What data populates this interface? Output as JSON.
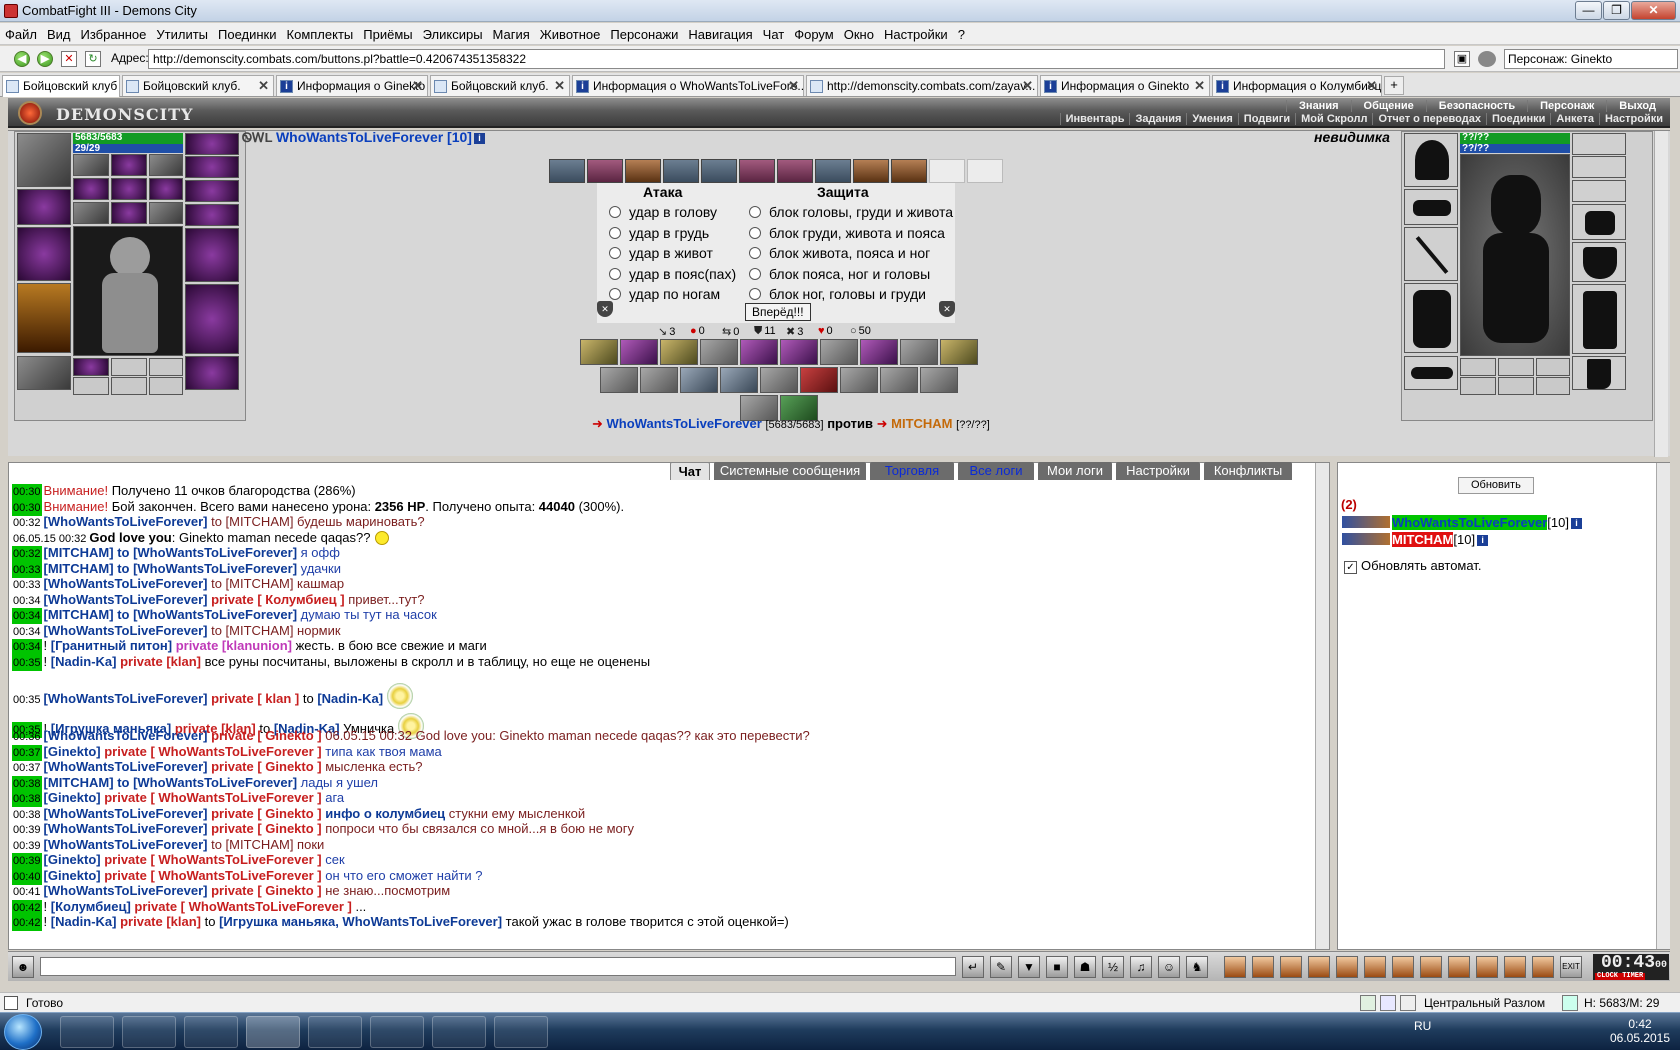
{
  "window": {
    "title": "CombatFight III - Demons City",
    "min": "0",
    "max": "1",
    "close": "r"
  },
  "menu": [
    "Файл",
    "Вид",
    "Избранное",
    "Утилиты",
    "Поединки",
    "Комплекты",
    "Приёмы",
    "Эликсиры",
    "Магия",
    "Животное",
    "Персонажи",
    "Навигация",
    "Чат",
    "Форум",
    "Окно",
    "Настройки",
    "?"
  ],
  "address": {
    "label": "Адрес:",
    "url": "http://demonscity.combats.com/buttons.pl?battle=0.420674351358322",
    "character_label": "Персонаж:",
    "character": "Ginekto"
  },
  "tabs": [
    "Бойцовский клуб",
    "Бойцовский клуб.",
    "Информация о Ginekto",
    "Бойцовский клуб.",
    "Информация о WhoWantsToLiveFore...",
    "http://demonscity.combats.com/zayav...",
    "Информация о Ginekto",
    "Информация о Колумбиец"
  ],
  "game": {
    "logo": "DEMONSCITY",
    "nav_top": [
      "Знания",
      "Общение",
      "Безопасность",
      "Персонаж",
      "Выход"
    ],
    "nav_bottom": [
      "Инвентарь",
      "Задания",
      "Умения",
      "Подвиги",
      "Мой Скролл",
      "Отчет о переводах",
      "Поединки",
      "Анкета",
      "Настройки"
    ],
    "player": {
      "name": "WhoWantsToLiveForever [10]",
      "hp": "5683/5683",
      "mp": "29/29",
      "clan_tag": "ᏫᎳL"
    },
    "enemy": {
      "hp": "??/??",
      "mp": "??/??",
      "label": "невидимка"
    },
    "attack_header": "Атака",
    "defense_header": "Защита",
    "attacks": [
      "удар в голову",
      "удар в грудь",
      "удар в живот",
      "удар в пояс(пах)",
      "удар по ногам"
    ],
    "defenses": [
      "блок головы, груди и живота",
      "блок груди, живота и пояса",
      "блок живота, пояса и ног",
      "блок пояса, ног и головы",
      "блок ног, головы и груди"
    ],
    "forward_button": "Вперёд!!!",
    "stats": [
      {
        "icon": "sword-icon",
        "value": "3"
      },
      {
        "icon": "blood-icon",
        "value": "0"
      },
      {
        "icon": "arrows-icon",
        "value": "0"
      },
      {
        "icon": "shield-icon",
        "value": "11"
      },
      {
        "icon": "cross-icon",
        "value": "3"
      },
      {
        "icon": "heart-icon",
        "value": "0"
      },
      {
        "icon": "drop-icon",
        "value": "50"
      }
    ],
    "versus": {
      "left_name": "WhoWantsToLiveForever",
      "left_hp": "[5683/5683]",
      "word": "против",
      "right_name": "MITCHAM",
      "right_hp": "[??/??]"
    },
    "colors": {
      "player": "#0a3fbd",
      "enemy": "#c46a0a",
      "hp": "#129b25",
      "mp": "#1f4fa8"
    }
  },
  "chat": {
    "tabs": [
      "Чат",
      "Системные сообщения",
      "Торговля",
      "Все логи",
      "Мои логи",
      "Настройки",
      "Конфликты"
    ],
    "lines": [
      {
        "t": "00:30",
        "g": true,
        "parts": [
          {
            "c": "rdn",
            "x": "Внимание!"
          },
          {
            "c": "bk",
            "x": " Получено 11 очков благородства (286%)"
          }
        ]
      },
      {
        "t": "00:30",
        "g": true,
        "parts": [
          {
            "c": "rdn",
            "x": "Внимание!"
          },
          {
            "c": "bk",
            "x": " Бой закончен. Всего вами нанесено урона: "
          },
          {
            "c": "bk bold",
            "x": "2356 HP"
          },
          {
            "c": "bk",
            "x": ". Получено опыта: "
          },
          {
            "c": "bk bold",
            "x": "44040"
          },
          {
            "c": "bk",
            "x": " (300%)."
          }
        ]
      },
      {
        "t": "00:32",
        "g": false,
        "parts": [
          {
            "c": "nm",
            "x": "[WhoWantsToLiveForever]"
          },
          {
            "c": "br",
            "x": " to [MITCHAM] будешь мариновать?"
          }
        ]
      },
      {
        "t": "06.05.15 00:32",
        "g": false,
        "parts": [
          {
            "c": "bk bold",
            "x": "God love you"
          },
          {
            "c": "bk",
            "x": ": Ginekto maman necede qaqas??"
          }
        ],
        "smile": true
      },
      {
        "t": "00:32",
        "g": true,
        "parts": [
          {
            "c": "nm",
            "x": "[MITCHAM]"
          },
          {
            "c": "nm",
            "x": " to [WhoWantsToLiveForever]"
          },
          {
            "c": "bl",
            "x": " я офф"
          }
        ]
      },
      {
        "t": "00:33",
        "g": true,
        "parts": [
          {
            "c": "nm",
            "x": "[MITCHAM]"
          },
          {
            "c": "nm",
            "x": " to [WhoWantsToLiveForever]"
          },
          {
            "c": "bl",
            "x": " удачки"
          }
        ]
      },
      {
        "t": "00:33",
        "g": false,
        "parts": [
          {
            "c": "nm",
            "x": "[WhoWantsToLiveForever]"
          },
          {
            "c": "br",
            "x": " to [MITCHAM] кашмар"
          }
        ]
      },
      {
        "t": "00:34",
        "g": false,
        "parts": [
          {
            "c": "nm",
            "x": "[WhoWantsToLiveForever]"
          },
          {
            "c": "pr",
            "x": " private [ Колумбиец ]"
          },
          {
            "c": "br",
            "x": " привет...тут?"
          }
        ]
      },
      {
        "t": "00:34",
        "g": true,
        "parts": [
          {
            "c": "nm",
            "x": "[MITCHAM]"
          },
          {
            "c": "nm",
            "x": " to [WhoWantsToLiveForever]"
          },
          {
            "c": "bl",
            "x": " думаю ты тут на часок"
          }
        ]
      },
      {
        "t": "00:34",
        "g": false,
        "parts": [
          {
            "c": "nm",
            "x": "[WhoWantsToLiveForever]"
          },
          {
            "c": "br",
            "x": " to [MITCHAM] нормик"
          }
        ]
      },
      {
        "t": "00:34",
        "g": true,
        "parts": [
          {
            "c": "bk",
            "x": "! "
          },
          {
            "c": "nm",
            "x": "[Гранитный питон]"
          },
          {
            "c": "mg",
            "x": " private [klanunion]"
          },
          {
            "c": "bk",
            "x": " жесть. в бою все свежие и маги"
          }
        ]
      },
      {
        "t": "00:35",
        "g": true,
        "parts": [
          {
            "c": "bk",
            "x": "! "
          },
          {
            "c": "nm",
            "x": "[Nadin-Ka]"
          },
          {
            "c": "pr",
            "x": " private [klan]"
          },
          {
            "c": "bk",
            "x": " все руны посчитаны, выложены в скролл и в таблицу, но еще не оценены"
          }
        ]
      },
      {
        "t": "00:35",
        "g": false,
        "parts": [
          {
            "c": "nm",
            "x": "[WhoWantsToLiveForever]"
          },
          {
            "c": "pr",
            "x": " private [ klan ]"
          },
          {
            "c": "bk",
            "x": " to "
          },
          {
            "c": "nm",
            "x": "[Nadin-Ka]"
          }
        ],
        "flower": true
      },
      {
        "t": "00:35",
        "g": true,
        "parts": [
          {
            "c": "bk",
            "x": "! "
          },
          {
            "c": "nm",
            "x": "[Игрушка маньяка]"
          },
          {
            "c": "pr",
            "x": " private [klan]"
          },
          {
            "c": "bk",
            "x": " to "
          },
          {
            "c": "nm",
            "x": "[Nadin-Ka]"
          },
          {
            "c": "bk",
            "x": " Умничка"
          }
        ],
        "flower": true
      },
      {
        "t": "00:36",
        "g": false,
        "parts": [
          {
            "c": "nm",
            "x": "[WhoWantsToLiveForever]"
          },
          {
            "c": "pr",
            "x": " private [ Ginekto ]"
          },
          {
            "c": "br",
            "x": " 06.05.15 00:32 God love you: Ginekto maman necede qaqas?? как это перевести?"
          }
        ]
      },
      {
        "t": "00:37",
        "g": true,
        "parts": [
          {
            "c": "nm",
            "x": "[Ginekto]"
          },
          {
            "c": "pr",
            "x": " private [ WhoWantsToLiveForever ]"
          },
          {
            "c": "bl",
            "x": " типа как твоя мама"
          }
        ]
      },
      {
        "t": "00:37",
        "g": false,
        "parts": [
          {
            "c": "nm",
            "x": "[WhoWantsToLiveForever]"
          },
          {
            "c": "pr",
            "x": " private [ Ginekto ]"
          },
          {
            "c": "br",
            "x": " мысленка есть?"
          }
        ]
      },
      {
        "t": "00:38",
        "g": true,
        "parts": [
          {
            "c": "nm",
            "x": "[MITCHAM]"
          },
          {
            "c": "nm",
            "x": " to [WhoWantsToLiveForever]"
          },
          {
            "c": "bl",
            "x": " лады я ушел"
          }
        ]
      },
      {
        "t": "00:38",
        "g": true,
        "parts": [
          {
            "c": "nm",
            "x": "[Ginekto]"
          },
          {
            "c": "pr",
            "x": " private [ WhoWantsToLiveForever ]"
          },
          {
            "c": "bl",
            "x": " ага"
          }
        ]
      },
      {
        "t": "00:38",
        "g": false,
        "parts": [
          {
            "c": "nm",
            "x": "[WhoWantsToLiveForever]"
          },
          {
            "c": "pr",
            "x": " private [ Ginekto ]"
          },
          {
            "c": "nm",
            "x": " инфо о колумбиец"
          },
          {
            "c": "br",
            "x": " стукни ему мысленкой"
          }
        ]
      },
      {
        "t": "00:39",
        "g": false,
        "parts": [
          {
            "c": "nm",
            "x": "[WhoWantsToLiveForever]"
          },
          {
            "c": "pr",
            "x": " private [ Ginekto ]"
          },
          {
            "c": "br",
            "x": " попроси что бы связался со мной...я в бою не могу"
          }
        ]
      },
      {
        "t": "00:39",
        "g": false,
        "parts": [
          {
            "c": "nm",
            "x": "[WhoWantsToLiveForever]"
          },
          {
            "c": "br",
            "x": " to [MITCHAM] поки"
          }
        ]
      },
      {
        "t": "00:39",
        "g": true,
        "parts": [
          {
            "c": "nm",
            "x": "[Ginekto]"
          },
          {
            "c": "pr",
            "x": " private [ WhoWantsToLiveForever ]"
          },
          {
            "c": "bl",
            "x": " сек"
          }
        ]
      },
      {
        "t": "00:40",
        "g": true,
        "parts": [
          {
            "c": "nm",
            "x": "[Ginekto]"
          },
          {
            "c": "pr",
            "x": " private [ WhoWantsToLiveForever ]"
          },
          {
            "c": "bl",
            "x": " он что его сможет найти ?"
          }
        ]
      },
      {
        "t": "00:41",
        "g": false,
        "parts": [
          {
            "c": "nm",
            "x": "[WhoWantsToLiveForever]"
          },
          {
            "c": "pr",
            "x": " private [ Ginekto ]"
          },
          {
            "c": "br",
            "x": " не знаю...посмотрим"
          }
        ]
      },
      {
        "t": "00:42",
        "g": true,
        "parts": [
          {
            "c": "bk",
            "x": "! "
          },
          {
            "c": "nm",
            "x": "[Колумбиец]"
          },
          {
            "c": "pr",
            "x": " private [ WhoWantsToLiveForever ]"
          },
          {
            "c": "bk",
            "x": " ..."
          }
        ]
      },
      {
        "t": "00:42",
        "g": true,
        "parts": [
          {
            "c": "bk",
            "x": "! "
          },
          {
            "c": "nm",
            "x": "[Nadin-Ka]"
          },
          {
            "c": "pr",
            "x": " private [klan]"
          },
          {
            "c": "bk",
            "x": " to "
          },
          {
            "c": "nm",
            "x": "[Игрушка маньяка, WhoWantsToLiveForever]"
          },
          {
            "c": "bk",
            "x": " такой ужас в голове творится с этой оценкой=)"
          }
        ]
      }
    ]
  },
  "right_panel": {
    "refresh_button": "Обновить",
    "count": "(2)",
    "players": [
      {
        "name": "WhoWantsToLiveForever",
        "level": "[10]",
        "color": "#00c400"
      },
      {
        "name": "MITCHAM",
        "level": "[10]",
        "color": "#e01010"
      }
    ],
    "auto_label": "Обновлять автомат.",
    "auto_checked": true
  },
  "toolbar": {
    "clock": "00:43",
    "clock_small": "00",
    "clock_label": "CLOCK TIMER"
  },
  "status": {
    "ready": "Готово",
    "location": "Центральный Разлом",
    "hp_mp": "H: 5683/M: 29"
  },
  "taskbar": {
    "lang": "RU",
    "time": "0:42",
    "date": "06.05.2015"
  }
}
